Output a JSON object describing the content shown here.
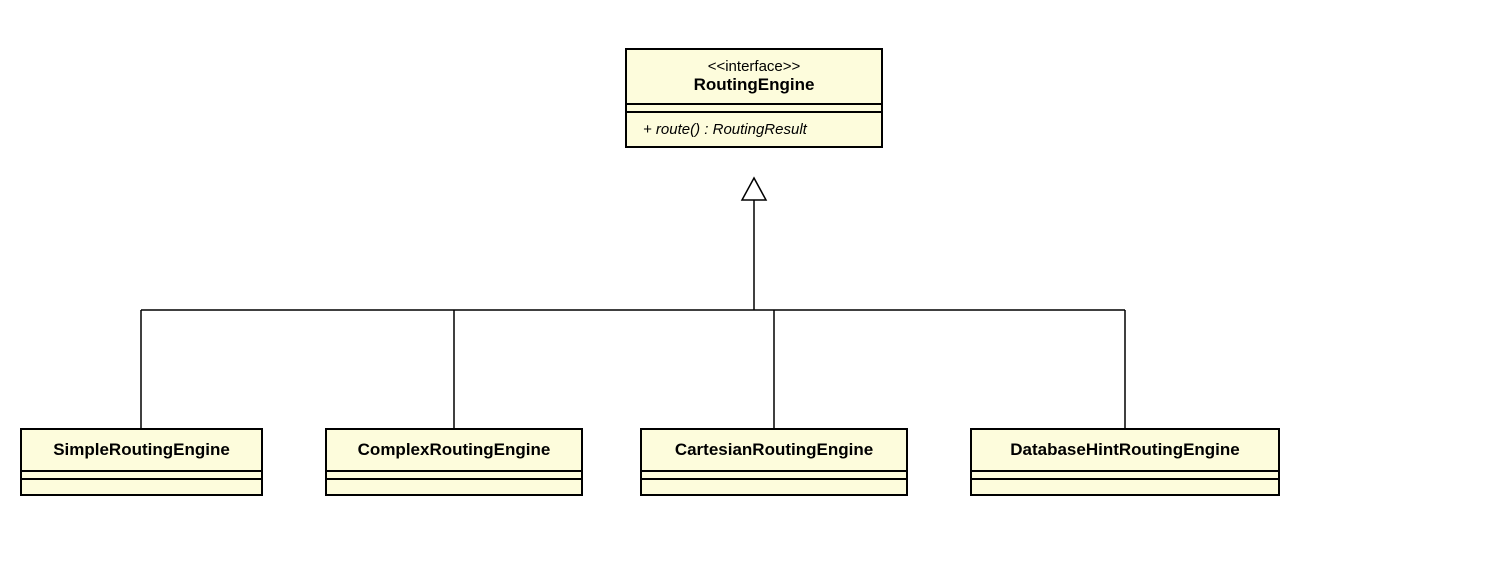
{
  "interface": {
    "stereotype": "<<interface>>",
    "name": "RoutingEngine",
    "operation": "+ route() : RoutingResult"
  },
  "subclasses": {
    "simple": "SimpleRoutingEngine",
    "complex": "ComplexRoutingEngine",
    "cartesian": "CartesianRoutingEngine",
    "databaseHint": "DatabaseHintRoutingEngine"
  }
}
